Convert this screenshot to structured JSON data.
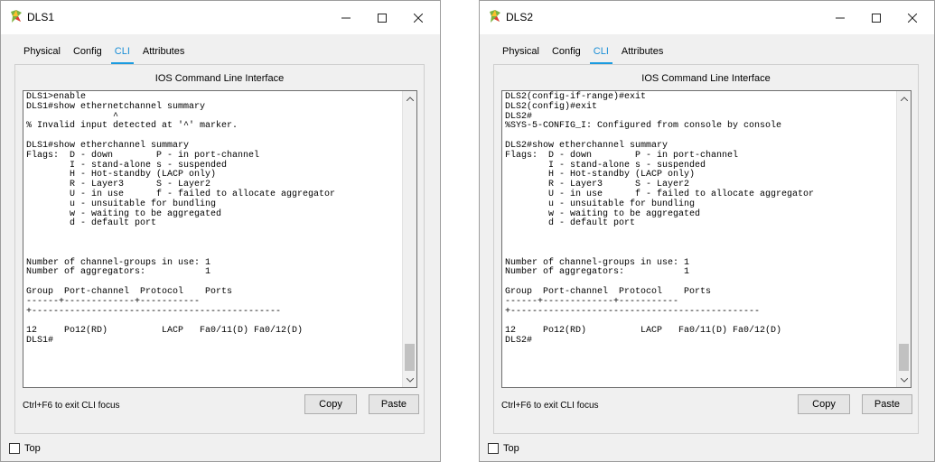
{
  "windows": [
    {
      "title": "DLS1",
      "tabs": [
        "Physical",
        "Config",
        "CLI",
        "Attributes"
      ],
      "active_tab": "CLI",
      "panel_title": "IOS Command Line Interface",
      "terminal_text": "DLS1>enable\nDLS1#show ethernetchannel summary\n                ^\n% Invalid input detected at '^' marker.\n\nDLS1#show etherchannel summary\nFlags:  D - down        P - in port-channel\n        I - stand-alone s - suspended\n        H - Hot-standby (LACP only)\n        R - Layer3      S - Layer2\n        U - in use      f - failed to allocate aggregator\n        u - unsuitable for bundling\n        w - waiting to be aggregated\n        d - default port\n\n\n\nNumber of channel-groups in use: 1\nNumber of aggregators:           1\n\nGroup  Port-channel  Protocol    Ports\n------+-------------+-----------\n+----------------------------------------------\n\n12     Po12(RD)          LACP   Fa0/11(D) Fa0/12(D)\nDLS1#",
      "hint": "Ctrl+F6 to exit CLI focus",
      "copy_label": "Copy",
      "paste_label": "Paste",
      "top_label": "Top"
    },
    {
      "title": "DLS2",
      "tabs": [
        "Physical",
        "Config",
        "CLI",
        "Attributes"
      ],
      "active_tab": "CLI",
      "panel_title": "IOS Command Line Interface",
      "terminal_text": "DLS2(config-if-range)#exit\nDLS2(config)#exit\nDLS2#\n%SYS-5-CONFIG_I: Configured from console by console\n\nDLS2#show etherchannel summary\nFlags:  D - down        P - in port-channel\n        I - stand-alone s - suspended\n        H - Hot-standby (LACP only)\n        R - Layer3      S - Layer2\n        U - in use      f - failed to allocate aggregator\n        u - unsuitable for bundling\n        w - waiting to be aggregated\n        d - default port\n\n\n\nNumber of channel-groups in use: 1\nNumber of aggregators:           1\n\nGroup  Port-channel  Protocol    Ports\n------+-------------+-----------\n+----------------------------------------------\n\n12     Po12(RD)          LACP   Fa0/11(D) Fa0/12(D)\nDLS2#",
      "hint": "Ctrl+F6 to exit CLI focus",
      "copy_label": "Copy",
      "paste_label": "Paste",
      "top_label": "Top"
    }
  ],
  "icons": {
    "app": "packet-tracer-device-icon",
    "minimize": "minimize-icon",
    "maximize": "maximize-icon",
    "close": "close-icon"
  },
  "colors": {
    "accent": "#1a9be0",
    "window_bg": "#f0f0f0",
    "terminal_bg": "#ffffff"
  }
}
